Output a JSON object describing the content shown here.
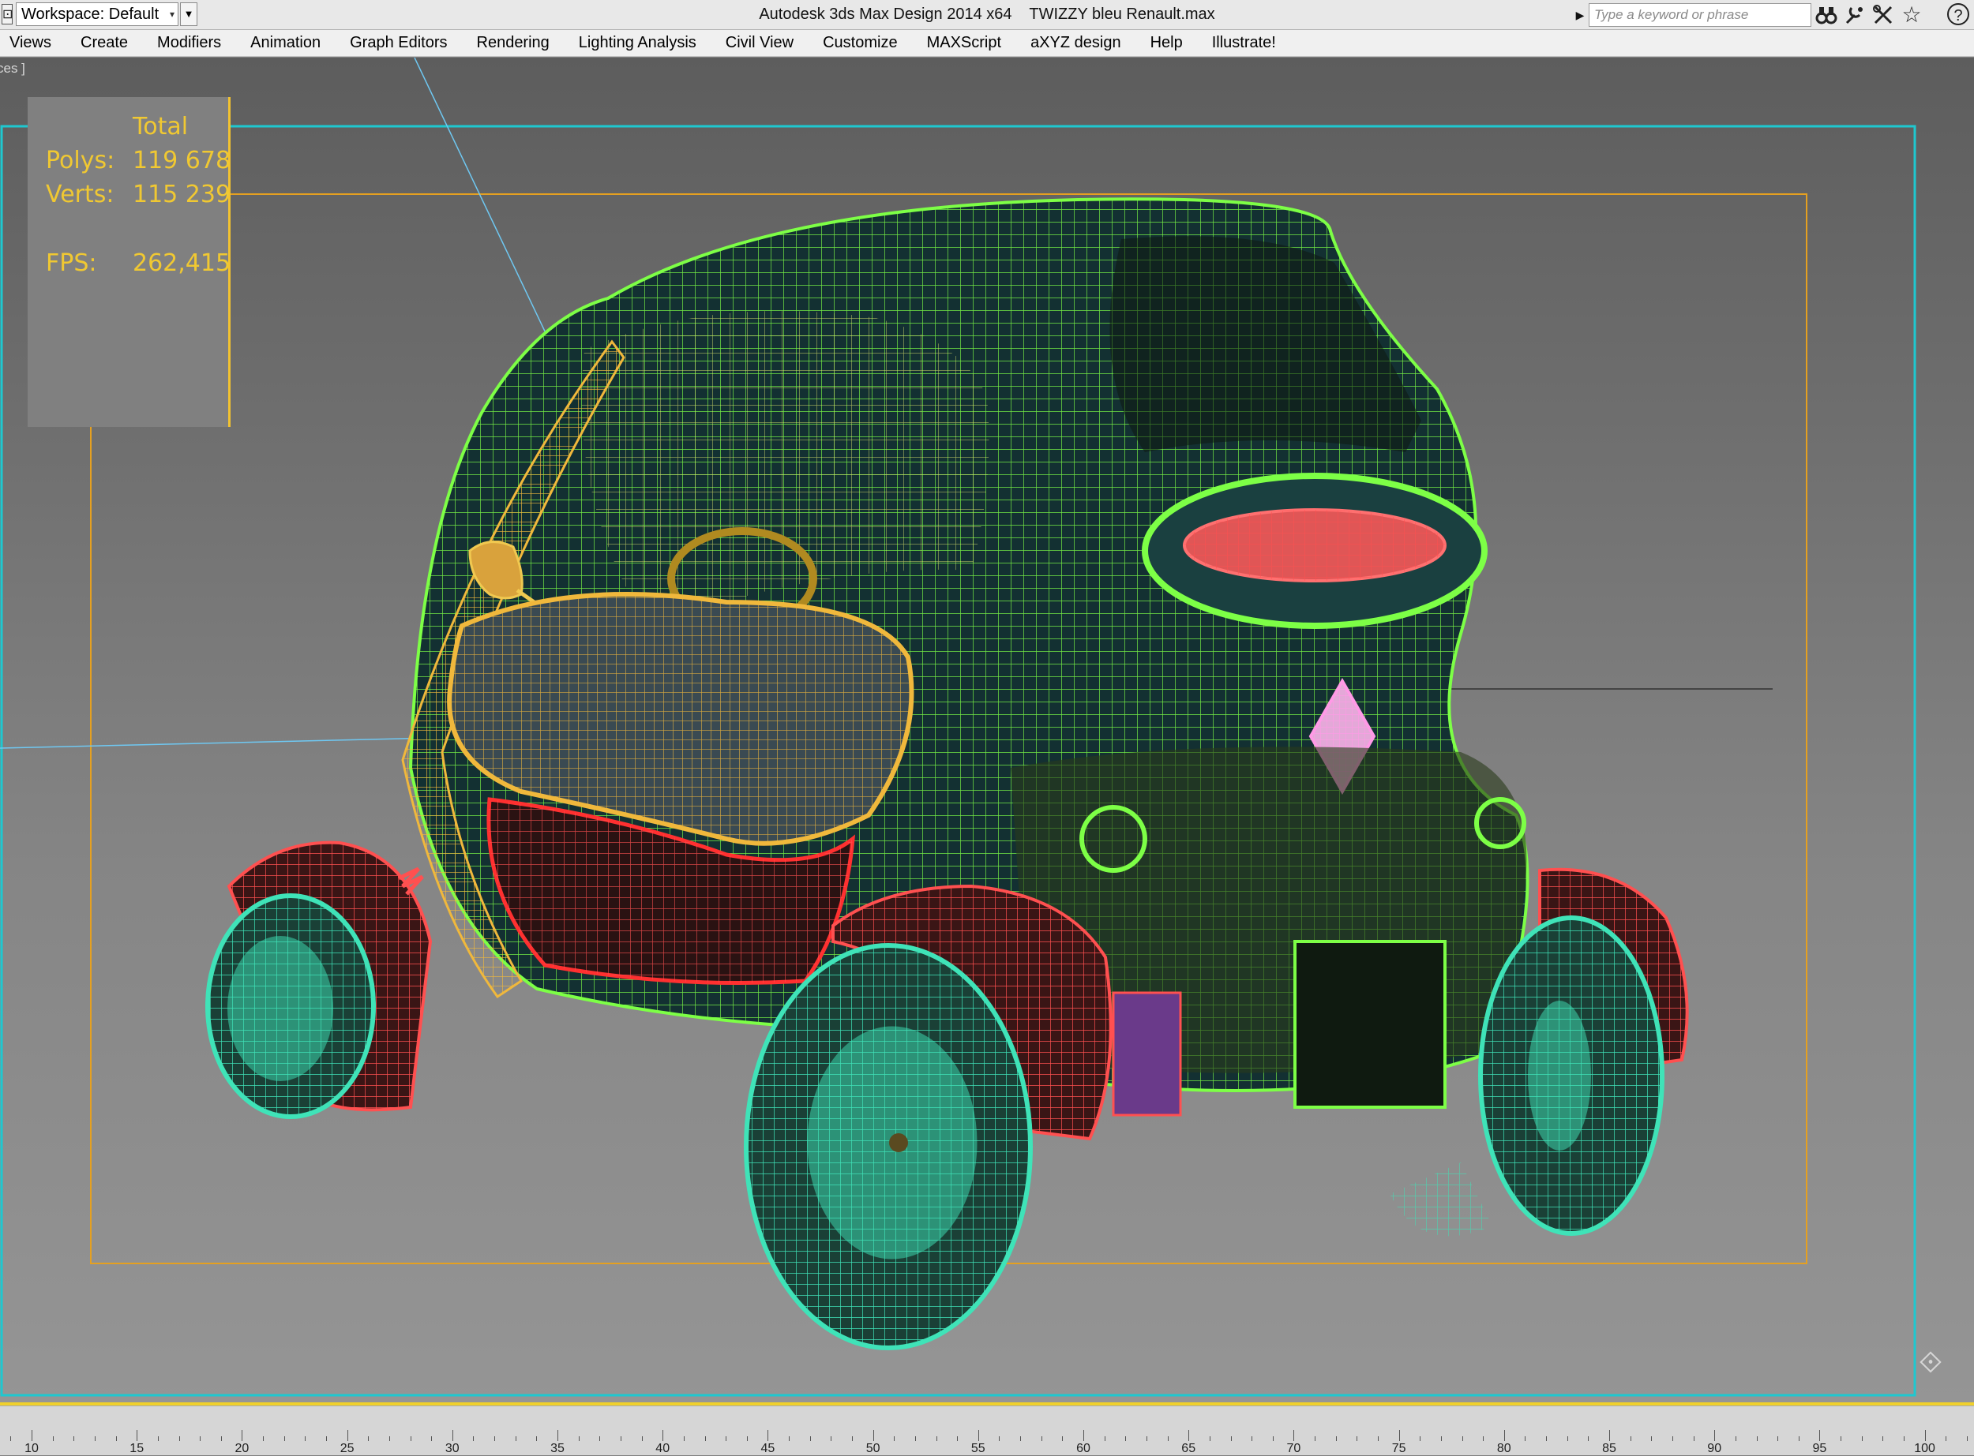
{
  "titlebar": {
    "workspace_label": "Workspace: Default",
    "app_title": "Autodesk 3ds Max Design 2014 x64",
    "file_name": "TWIZZY bleu Renault.max",
    "search_placeholder": "Type a keyword or phrase",
    "icons": [
      "binoculars-icon",
      "connect-icon",
      "tools-icon",
      "favorites-star-icon",
      "help-icon"
    ]
  },
  "menubar": {
    "items": [
      "Views",
      "Create",
      "Modifiers",
      "Animation",
      "Graph Editors",
      "Rendering",
      "Lighting Analysis",
      "Civil View",
      "Customize",
      "MAXScript",
      "aXYZ design",
      "Help",
      "Illustrate!"
    ]
  },
  "viewport": {
    "label": "ces ]",
    "object": "Renault Twizy wireframe model",
    "stats": {
      "header": "Total",
      "polys_label": "Polys:",
      "polys_value": "119 678",
      "verts_label": "Verts:",
      "verts_value": "115 239",
      "fps_label": "FPS:",
      "fps_value": "262,415"
    },
    "colors": {
      "stats_text": "#f0c832",
      "body_wire": "#7dff46",
      "wheel_wire": "#3fe3b8",
      "fender_wire": "#ff5050",
      "seat_wire": "#f0b83c",
      "frame_orange": "#e5a020",
      "safe_frame_cyan": "#1ec8d0"
    }
  },
  "timeline": {
    "ticks": [
      "10",
      "15",
      "20",
      "25",
      "30",
      "35",
      "40",
      "45",
      "50",
      "55",
      "60",
      "65",
      "70",
      "75",
      "80",
      "85",
      "90",
      "95",
      "100"
    ]
  }
}
